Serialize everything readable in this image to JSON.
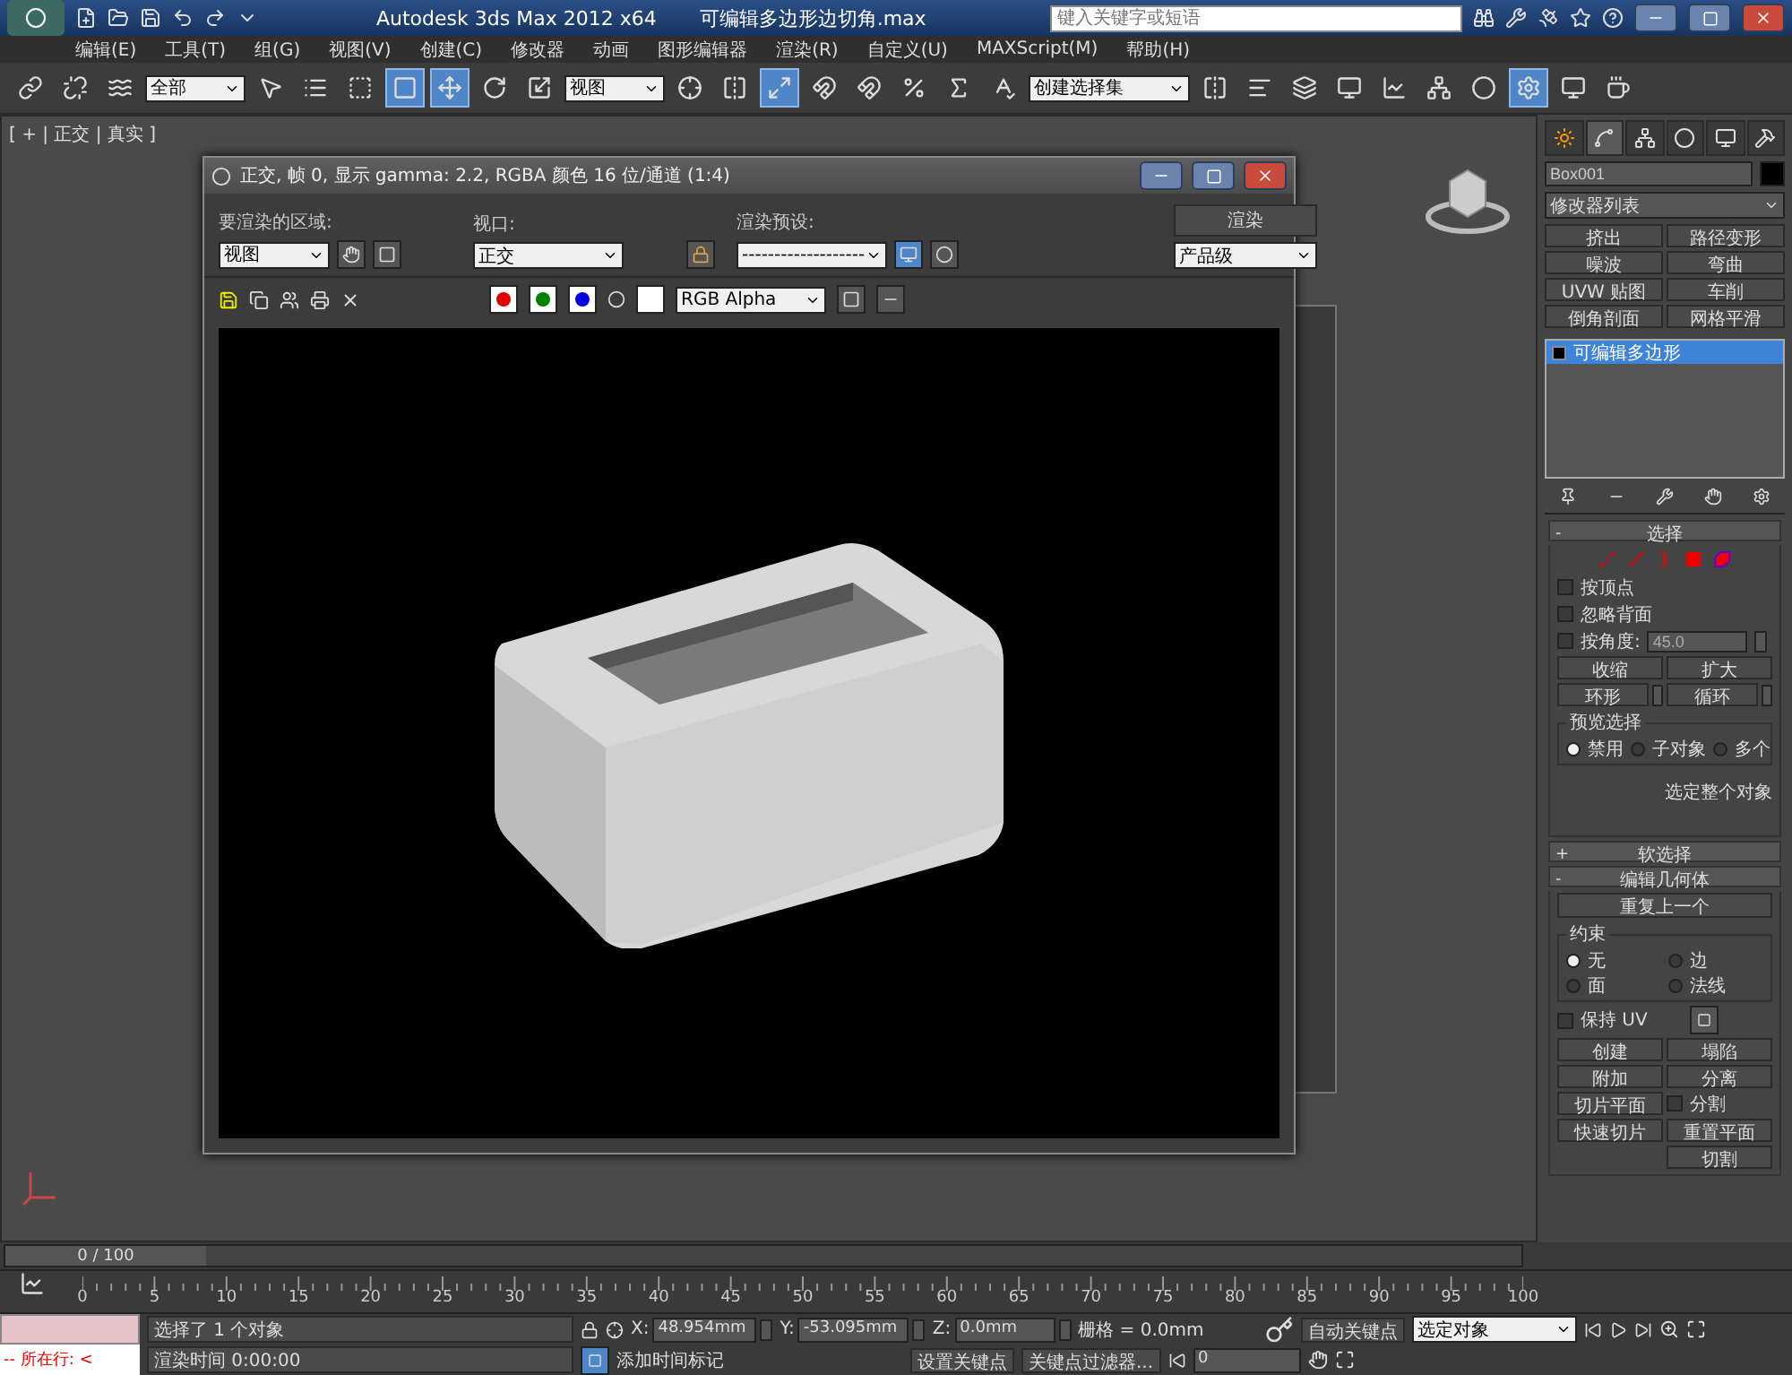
{
  "title_bar": {
    "title": "Autodesk 3ds Max  2012 x64",
    "file": "可编辑多边形边切角.max",
    "search": {
      "placeholder": "键入关键字或短语"
    }
  },
  "menu": [
    "编辑(E)",
    "工具(T)",
    "组(G)",
    "视图(V)",
    "创建(C)",
    "修改器",
    "动画",
    "图形编辑器",
    "渲染(R)",
    "自定义(U)",
    "MAXScript(M)",
    "帮助(H)"
  ],
  "toolbar": [
    {
      "kind": "icon",
      "active": false
    },
    {
      "kind": "icon",
      "active": false
    },
    {
      "kind": "icon",
      "active": false
    },
    {
      "kind": "dropdown",
      "value": "全部"
    },
    {
      "kind": "icon",
      "active": false
    },
    {
      "kind": "icon",
      "active": false
    },
    {
      "kind": "icon",
      "active": false
    },
    {
      "kind": "icon",
      "active": true
    },
    {
      "kind": "icon",
      "active": true
    },
    {
      "kind": "icon",
      "active": false
    },
    {
      "kind": "icon",
      "active": false
    },
    {
      "kind": "dropdown",
      "value": "视图"
    },
    {
      "kind": "icon",
      "active": false
    },
    {
      "kind": "icon",
      "active": false
    },
    {
      "kind": "icon",
      "active": true
    },
    {
      "kind": "icon",
      "active": false
    },
    {
      "kind": "icon",
      "active": false
    },
    {
      "kind": "icon",
      "active": false
    },
    {
      "kind": "icon",
      "active": false
    },
    {
      "kind": "icon",
      "active": false
    },
    {
      "kind": "dropdown",
      "value": "创建选择集"
    },
    {
      "kind": "icon",
      "active": false
    },
    {
      "kind": "icon",
      "active": false
    },
    {
      "kind": "icon",
      "active": false
    },
    {
      "kind": "icon",
      "active": false
    },
    {
      "kind": "icon",
      "active": false
    },
    {
      "kind": "icon",
      "active": false
    },
    {
      "kind": "icon",
      "active": false
    },
    {
      "kind": "icon",
      "active": true
    },
    {
      "kind": "icon",
      "active": false
    },
    {
      "kind": "icon",
      "active": false
    }
  ],
  "viewport": {
    "label": "[ + | 正交 | 真实 ]"
  },
  "render_window": {
    "title": "正交, 帧 0, 显示 gamma: 2.2, RGBA 颜色 16 位/通道 (1:4)",
    "area": {
      "label": "要渲染的区域:",
      "value": "视图"
    },
    "view": {
      "label": "视口:",
      "value": "正交"
    },
    "preset": {
      "label": "渲染预设:",
      "value": "-------------------"
    },
    "render_button": "渲染",
    "quality": "产品级",
    "channels": [
      {
        "color": "#e00000",
        "on": true
      },
      {
        "color": "#008000",
        "on": true
      },
      {
        "color": "#0000e0",
        "on": true
      }
    ],
    "display": "RGB Alpha"
  },
  "command_panel": {
    "tabs": [
      {
        "selected": false
      },
      {
        "selected": true
      },
      {
        "selected": false
      },
      {
        "selected": false
      },
      {
        "selected": false
      },
      {
        "selected": false
      }
    ],
    "object": {
      "name": "Box001",
      "color": "#000000"
    },
    "modifier_list": "修改器列表",
    "modifier_buttons": [
      "挤出",
      "路径变形",
      "噪波",
      "弯曲",
      "UVW 贴图",
      "车削",
      "倒角剖面",
      "网格平滑"
    ],
    "stack": [
      {
        "label": "可编辑多边形",
        "selected": true
      }
    ],
    "selection": {
      "sign": "-",
      "title": "选择",
      "levels": [
        {
          "selected": false
        },
        {
          "selected": false
        },
        {
          "selected": false
        },
        {
          "selected": false
        },
        {
          "selected": false
        }
      ],
      "options": [
        {
          "label": "按顶点",
          "checked": false
        },
        {
          "label": "忽略背面",
          "checked": false
        },
        {
          "label": "按角度:",
          "checked": false
        }
      ],
      "angle": "45.0",
      "buttons": [
        "收缩",
        "扩大"
      ],
      "spin_buttons": [
        "环形",
        "循环"
      ],
      "preview": {
        "title": "预览选择",
        "options": [
          {
            "label": "禁用",
            "selected": true
          },
          {
            "label": "子对象",
            "selected": false
          },
          {
            "label": "多个",
            "selected": false
          }
        ]
      },
      "info": "选定整个对象"
    },
    "soft_selection": {
      "sign": "+",
      "title": "软选择"
    },
    "edit_geometry": {
      "sign": "-",
      "title": "编辑几何体",
      "repeat": "重复上一个",
      "constraints": {
        "title": "约束",
        "options": [
          {
            "label": "无",
            "selected": true
          },
          {
            "label": "边",
            "selected": false
          },
          {
            "label": "面",
            "selected": false
          },
          {
            "label": "法线",
            "selected": false
          }
        ]
      },
      "preserve_uv": {
        "label": "保持 UV",
        "checked": false
      },
      "buttons": [
        "创建",
        "塌陷",
        "附加",
        "分离"
      ],
      "slice_plane": "切片平面",
      "split": {
        "label": "分割",
        "checked": false
      },
      "reset_plane": "重置平面",
      "quick_slice": "快速切片",
      "cut": "切割"
    }
  },
  "time_slider": {
    "label": "0 / 100",
    "level": 0
  },
  "ruler": [
    "0",
    "5",
    "10",
    "15",
    "20",
    "25",
    "30",
    "35",
    "40",
    "45",
    "50",
    "55",
    "60",
    "65",
    "70",
    "75",
    "80",
    "85",
    "90",
    "95",
    "100"
  ],
  "status": {
    "listener": "-- 所在行: <",
    "prompt": "选择了 1 个对象",
    "render_time": "渲染时间  0:00:00",
    "coords": [
      {
        "axis": "X:",
        "value": "48.954mm"
      },
      {
        "axis": "Y:",
        "value": "-53.095mm"
      },
      {
        "axis": "Z:",
        "value": "0.0mm"
      }
    ],
    "grid": "栅格 = 0.0mm",
    "add_tag": "添加时间标记",
    "auto_key": "自动关键点",
    "set_key": "设置关键点",
    "key_mode": "选定对象",
    "key_filters": "关键点过滤器...",
    "frame": "0"
  }
}
